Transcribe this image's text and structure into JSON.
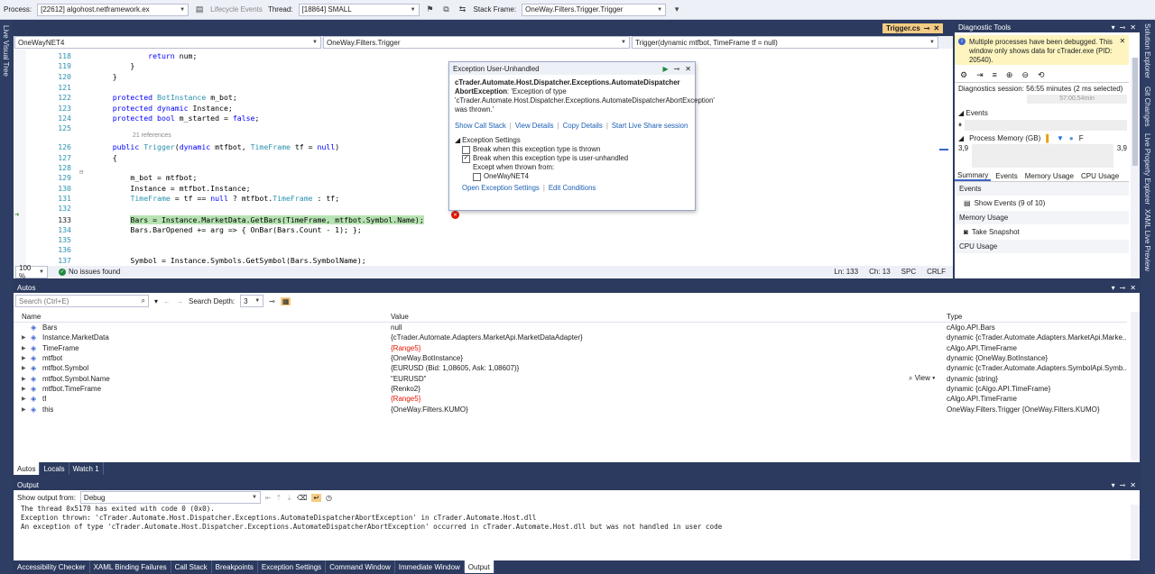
{
  "toolbar": {
    "process_label": "Process:",
    "process_value": "[22612] algohost.netframework.ex",
    "lifecycle_label": "Lifecycle Events",
    "thread_label": "Thread:",
    "thread_value": "[18864] SMALL",
    "stackframe_label": "Stack Frame:",
    "stackframe_value": "OneWay.Filters.Trigger.Trigger"
  },
  "left_sidebar": {
    "live_visual_tree": "Live Visual Tree"
  },
  "right_sidebar": {
    "items": [
      "Solution Explorer",
      "Git Changes",
      "Live Property Explorer",
      "XAML Live Preview"
    ]
  },
  "editor": {
    "tab_title": "Trigger.cs",
    "nav_project": "OneWayNET4",
    "nav_class": "OneWay.Filters.Trigger",
    "nav_member": "Trigger(dynamic mtfbot, TimeFrame tf = null)",
    "lines": [
      {
        "n": "118",
        "code": "            return num;"
      },
      {
        "n": "119",
        "code": "        }"
      },
      {
        "n": "120",
        "code": "    }"
      },
      {
        "n": "121",
        "code": ""
      },
      {
        "n": "122",
        "code": "    protected BotInstance m_bot;"
      },
      {
        "n": "123",
        "code": "    protected dynamic Instance;"
      },
      {
        "n": "124",
        "code": "    protected bool m_started = false;"
      },
      {
        "n": "125",
        "code": ""
      },
      {
        "n": "126",
        "code": "    public Trigger(dynamic mtfbot, TimeFrame tf = null)"
      },
      {
        "n": "127",
        "code": "    {"
      },
      {
        "n": "128",
        "code": ""
      },
      {
        "n": "129",
        "code": "        m_bot = mtfbot;"
      },
      {
        "n": "130",
        "code": "        Instance = mtfbot.Instance;"
      },
      {
        "n": "131",
        "code": "        TimeFrame = tf == null ? mtfbot.TimeFrame : tf;"
      },
      {
        "n": "132",
        "code": ""
      },
      {
        "n": "133",
        "code": "        Bars = Instance.MarketData.GetBars(TimeFrame, mtfbot.Symbol.Name);"
      },
      {
        "n": "134",
        "code": "        Bars.BarOpened += arg => { OnBar(Bars.Count - 1); };"
      },
      {
        "n": "135",
        "code": ""
      },
      {
        "n": "136",
        "code": ""
      },
      {
        "n": "137",
        "code": "        Symbol = Instance.Symbols.GetSymbol(Bars.SymbolName);"
      }
    ],
    "references_label": "21 references",
    "status": {
      "zoom": "100 %",
      "issues": "No issues found",
      "ln": "Ln: 133",
      "ch": "Ch: 13",
      "spc": "SPC",
      "crlf": "CRLF"
    }
  },
  "exception": {
    "title": "Exception User-Unhandled",
    "type_bold": "cTrader.Automate.Host.Dispatcher.Exceptions.AutomateDispatcher AbortException",
    "message": ": 'Exception of type 'cTrader.Automate.Host.Dispatcher.Exceptions.AutomateDispatcherAbortException' was thrown.'",
    "links": [
      "Show Call Stack",
      "View Details",
      "Copy Details",
      "Start Live Share session"
    ],
    "settings_label": "Exception Settings",
    "opt_thrown": "Break when this exception type is thrown",
    "opt_unhandled": "Break when this exception type is user-unhandled",
    "except_label": "Except when thrown from:",
    "module": "OneWayNET4",
    "footer_links": [
      "Open Exception Settings",
      "Edit Conditions"
    ]
  },
  "diagnostics": {
    "title": "Diagnostic Tools",
    "info": "Multiple processes have been debugged. This window only shows data for cTrader.exe (PID: 20540).",
    "session": "Diagnostics session: 56:55 minutes (2 ms selected)",
    "timeline_label": "57:00,54min",
    "events_label": "Events",
    "memory_label": "Process Memory (GB)",
    "memory_f": "F",
    "mem_left": "3,9",
    "mem_right": "3,9",
    "tabs": [
      "Summary",
      "Events",
      "Memory Usage",
      "CPU Usage"
    ],
    "sec_events": "Events",
    "show_events": "Show Events (9 of 10)",
    "sec_memory": "Memory Usage",
    "take_snapshot": "Take Snapshot",
    "sec_cpu": "CPU Usage"
  },
  "autos": {
    "title": "Autos",
    "search_placeholder": "Search (Ctrl+E)",
    "search_depth_label": "Search Depth:",
    "search_depth_value": "3",
    "columns": [
      "Name",
      "Value",
      "Type"
    ],
    "rows": [
      {
        "name": "Bars",
        "value": "null",
        "type": "cAlgo.API.Bars",
        "red": false
      },
      {
        "name": "Instance.MarketData",
        "value": "{cTrader.Automate.Adapters.MarketApi.MarketDataAdapter}",
        "type": "dynamic {cTrader.Automate.Adapters.MarketApi.Marke...",
        "red": false
      },
      {
        "name": "TimeFrame",
        "value": "{Range5}",
        "type": "cAlgo.API.TimeFrame",
        "red": true
      },
      {
        "name": "mtfbot",
        "value": "{OneWay.BotInstance}",
        "type": "dynamic {OneWay.BotInstance}",
        "red": false
      },
      {
        "name": "mtfbot.Symbol",
        "value": "{EURUSD (Bid: 1,08605, Ask: 1,08607)}",
        "type": "dynamic {cTrader.Automate.Adapters.SymbolApi.Symb...",
        "red": false
      },
      {
        "name": "mtfbot.Symbol.Name",
        "value": "\"EURUSD\"",
        "type": "dynamic {string}",
        "red": false
      },
      {
        "name": "mtfbot.TimeFrame",
        "value": "{Renko2}",
        "type": "dynamic {cAlgo.API.TimeFrame}",
        "red": false
      },
      {
        "name": "tf",
        "value": "{Range5}",
        "type": "cAlgo.API.TimeFrame",
        "red": true
      },
      {
        "name": "this",
        "value": "{OneWay.Filters.KUMO}",
        "type": "OneWay.Filters.Trigger {OneWay.Filters.KUMO}",
        "red": false
      }
    ],
    "view_label": "View",
    "tabs": [
      "Autos",
      "Locals",
      "Watch 1"
    ]
  },
  "output": {
    "title": "Output",
    "show_from_label": "Show output from:",
    "show_from_value": "Debug",
    "lines": [
      "The thread 0x5170 has exited with code 0 (0x0).",
      "Exception thrown: 'cTrader.Automate.Host.Dispatcher.Exceptions.AutomateDispatcherAbortException' in cTrader.Automate.Host.dll",
      "An exception of type 'cTrader.Automate.Host.Dispatcher.Exceptions.AutomateDispatcherAbortException' occurred in cTrader.Automate.Host.dll but was not handled in user code"
    ]
  },
  "bottom_tabs": [
    "Accessibility Checker",
    "XAML Binding Failures",
    "Call Stack",
    "Breakpoints",
    "Exception Settings",
    "Command Window",
    "Immediate Window",
    "Output"
  ],
  "colors": {
    "accent": "#3c64c8",
    "frame": "#2b3a5e",
    "highlight_line": "#b7e3b3",
    "error": "#e51400",
    "tab_active": "#f5cc84"
  }
}
